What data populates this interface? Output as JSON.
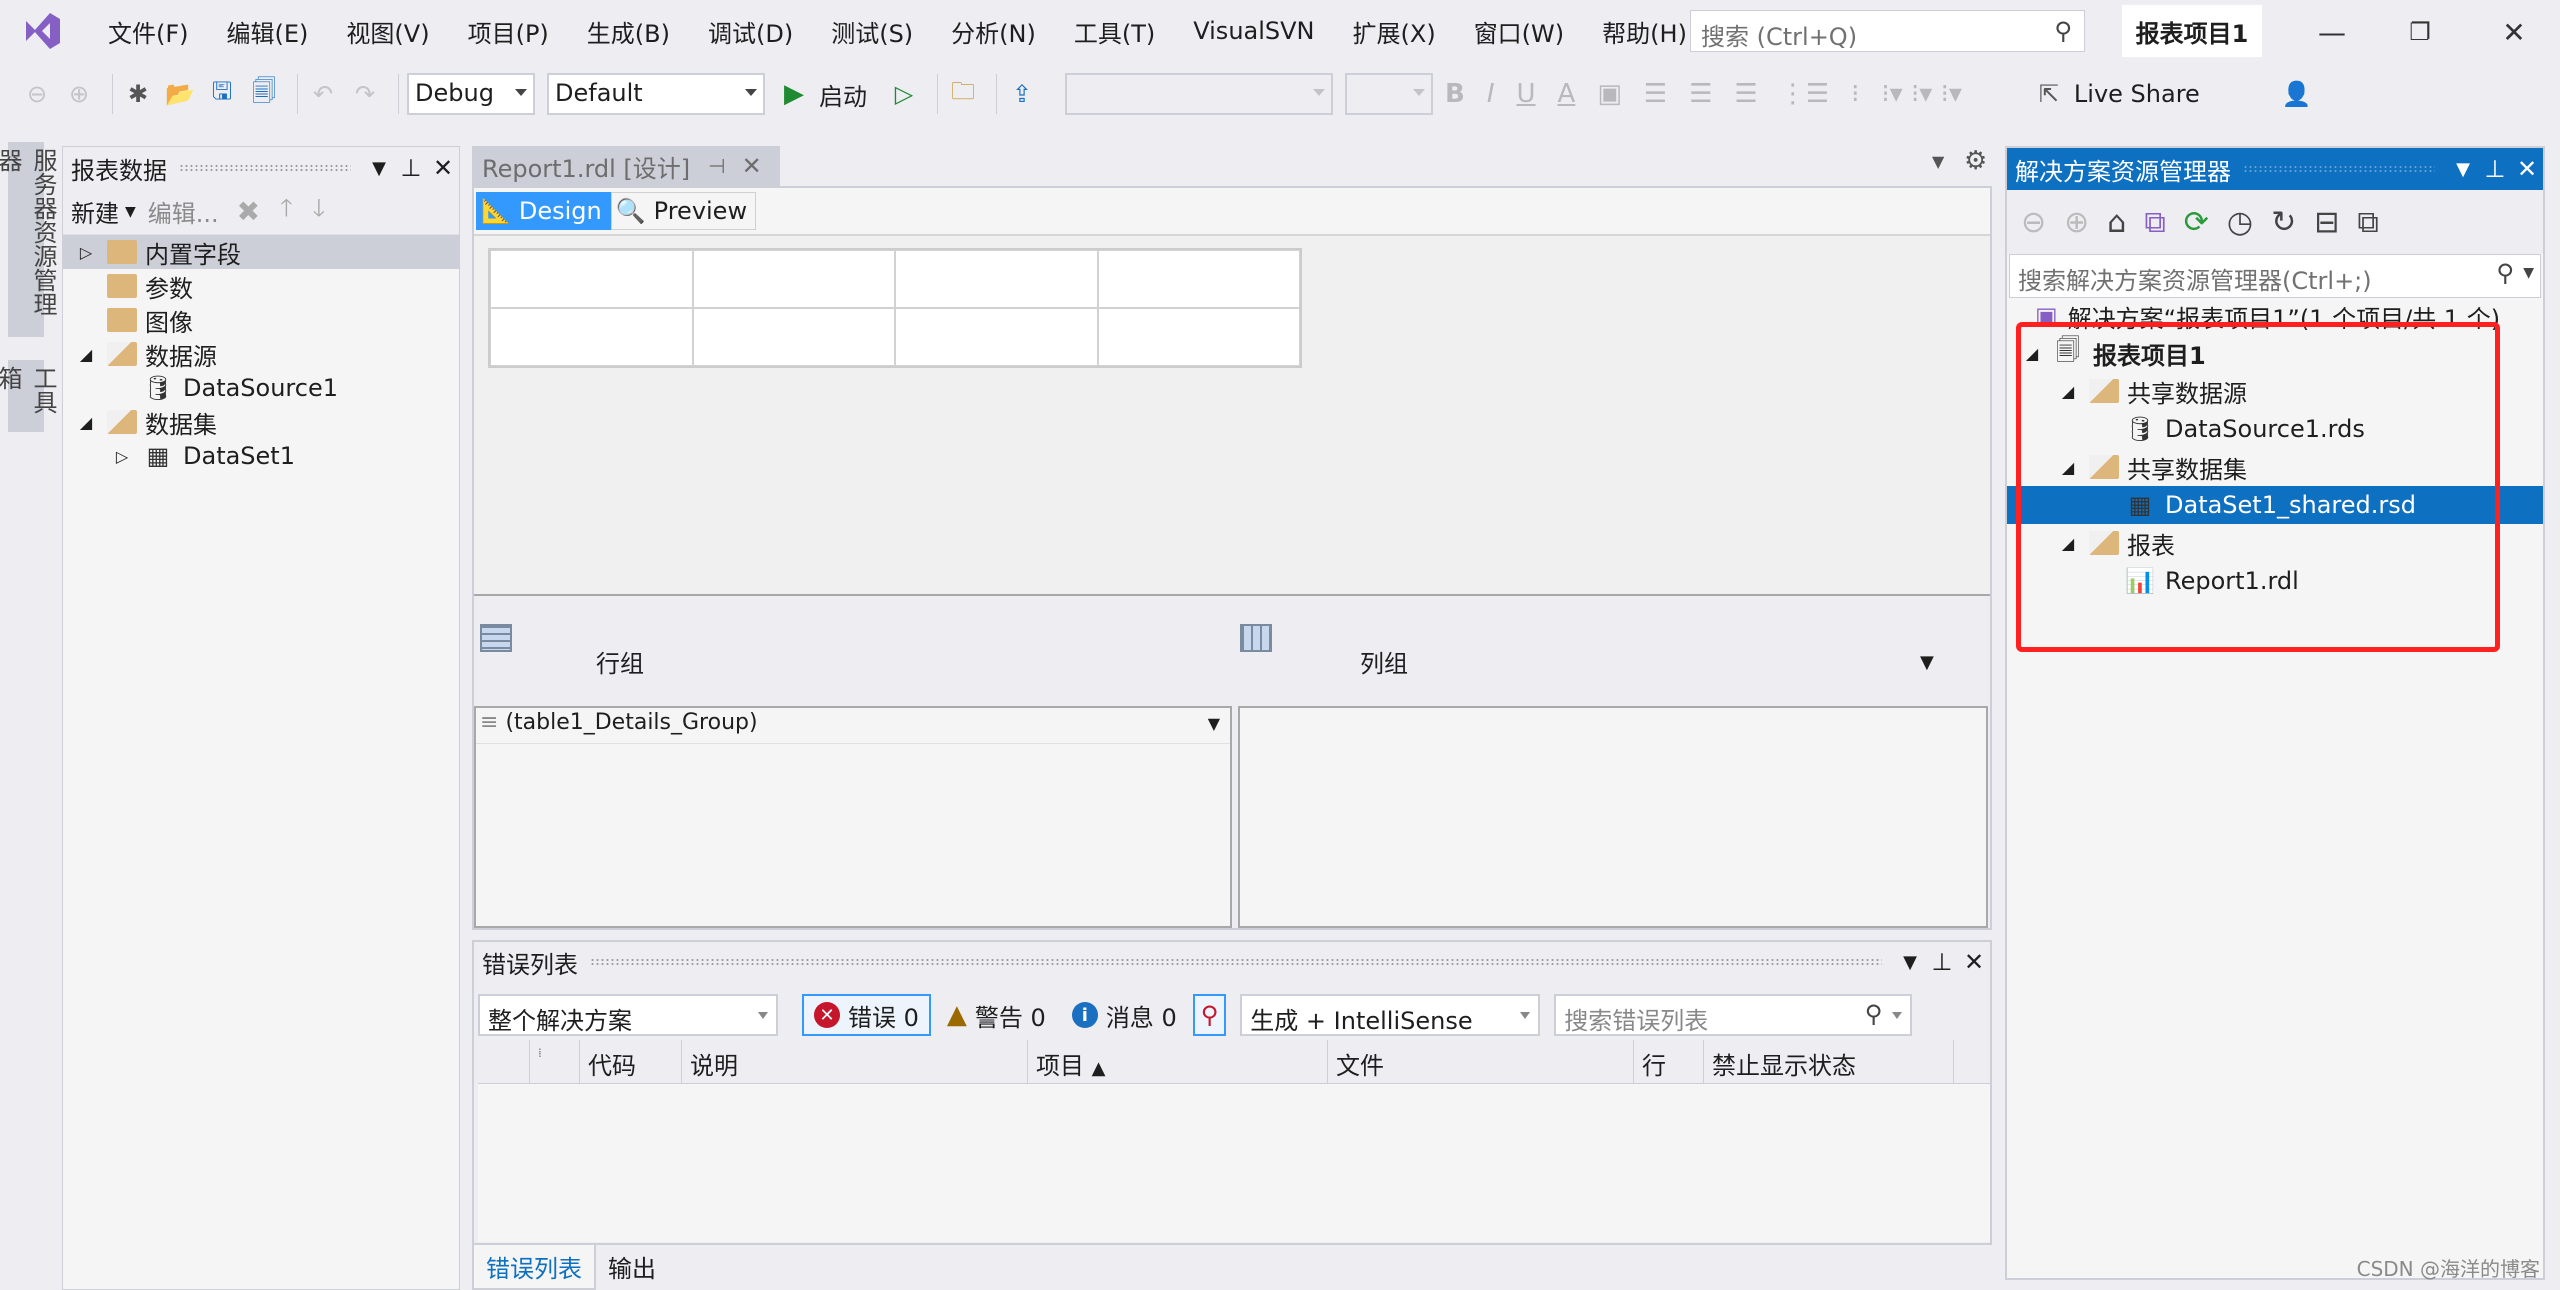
{
  "menubar": {
    "items": [
      "文件(F)",
      "编辑(E)",
      "视图(V)",
      "项目(P)",
      "生成(B)",
      "调试(D)",
      "测试(S)",
      "分析(N)",
      "工具(T)",
      "VisualSVN",
      "扩展(X)",
      "窗口(W)",
      "帮助(H)"
    ],
    "search_placeholder": "搜索 (Ctrl+Q)",
    "solution_title": "报表项目1"
  },
  "toolbar": {
    "config": "Debug",
    "platform": "Default",
    "start_label": "启动",
    "live_share": "Live Share",
    "font_name": "",
    "font_size": ""
  },
  "side_tabs": [
    "服务器资源管理器",
    "工具箱"
  ],
  "report_data": {
    "title": "报表数据",
    "new_label": "新建",
    "edit_label": "编辑...",
    "tree": [
      {
        "label": "内置字段",
        "expander": "collapsed",
        "icon": "folder",
        "indent": 0,
        "selected": true
      },
      {
        "label": "参数",
        "expander": "none",
        "icon": "folder",
        "indent": 0
      },
      {
        "label": "图像",
        "expander": "none",
        "icon": "folder",
        "indent": 0
      },
      {
        "label": "数据源",
        "expander": "expanded",
        "icon": "folder-open",
        "indent": 0
      },
      {
        "label": "DataSource1",
        "expander": "none",
        "icon": "datasource",
        "indent": 1
      },
      {
        "label": "数据集",
        "expander": "expanded",
        "icon": "folder-open",
        "indent": 0
      },
      {
        "label": "DataSet1",
        "expander": "collapsed",
        "icon": "dataset",
        "indent": 1
      }
    ]
  },
  "document": {
    "tab_label": "Report1.rdl [设计]",
    "design_tab": "Design",
    "preview_tab": "Preview",
    "table": {
      "rows": 2,
      "cols": 4
    },
    "row_groups_label": "行组",
    "column_groups_label": "列组",
    "row_group_item": "(table1_Details_Group)"
  },
  "error_list": {
    "title": "错误列表",
    "scope": "整个解决方案",
    "errors_label": "错误 0",
    "warnings_label": "警告 0",
    "messages_label": "消息 0",
    "source": "生成 + IntelliSense",
    "search_placeholder": "搜索错误列表",
    "columns": [
      "代码",
      "说明",
      "项目",
      "文件",
      "行",
      "禁止显示状态"
    ],
    "sorted_column": "项目",
    "rows": []
  },
  "bottom_tabs": [
    "错误列表",
    "输出"
  ],
  "solution_explorer": {
    "title": "解决方案资源管理器",
    "search_placeholder": "搜索解决方案资源管理器(Ctrl+;)",
    "solution_row": "解决方案“报表项目1”(1 个项目/共 1 个)",
    "tree": [
      {
        "label": "报表项目1",
        "icon": "project",
        "indent": 0,
        "expander": "expanded",
        "bold": true
      },
      {
        "label": "共享数据源",
        "icon": "folder-open",
        "indent": 1,
        "expander": "expanded"
      },
      {
        "label": "DataSource1.rds",
        "icon": "datasource",
        "indent": 2,
        "expander": "none"
      },
      {
        "label": "共享数据集",
        "icon": "folder-open",
        "indent": 1,
        "expander": "expanded"
      },
      {
        "label": "DataSet1_shared.rsd",
        "icon": "dataset",
        "indent": 2,
        "expander": "none",
        "selected": true
      },
      {
        "label": "报表",
        "icon": "folder-open",
        "indent": 1,
        "expander": "expanded"
      },
      {
        "label": "Report1.rdl",
        "icon": "report",
        "indent": 2,
        "expander": "none"
      }
    ],
    "highlight_color": "#ff2020"
  },
  "watermark": "CSDN @海洋的博客",
  "colors": {
    "accent": "#0e70c0",
    "design_tab": "#3399ff",
    "vs_purple": "#865fc5"
  }
}
